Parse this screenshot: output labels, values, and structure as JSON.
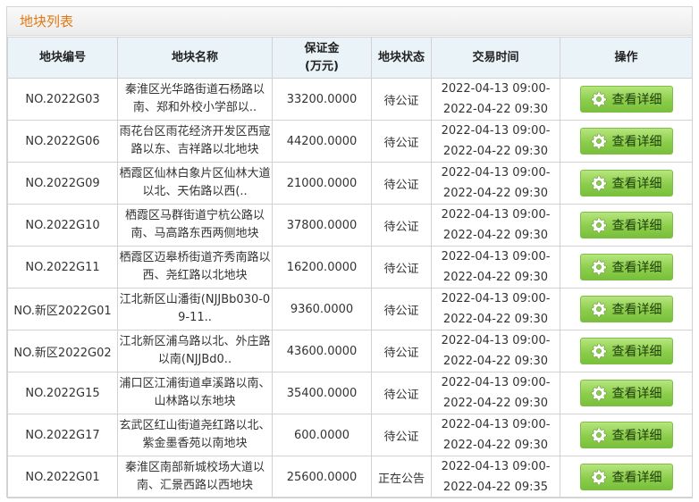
{
  "panel": {
    "title": "地块列表"
  },
  "table": {
    "headers": {
      "code": "地块编号",
      "name": "地块名称",
      "deposit_line1": "保证金",
      "deposit_line2": "(万元)",
      "status": "地块状态",
      "time": "交易时间",
      "action": "操作"
    },
    "rows": [
      {
        "code": "NO.2022G03",
        "name": "秦淮区光华路街道石杨路以南、郑和外校小学部以..",
        "deposit": "33200.0000",
        "status": "待公证",
        "time_start": "2022-04-13 09:00-",
        "time_end": "2022-04-22 09:30",
        "action": "查看详细"
      },
      {
        "code": "NO.2022G06",
        "name": "雨花台区雨花经济开发区西寇路以东、吉祥路以北地块",
        "deposit": "44200.0000",
        "status": "待公证",
        "time_start": "2022-04-13 09:00-",
        "time_end": "2022-04-22 09:30",
        "action": "查看详细"
      },
      {
        "code": "NO.2022G09",
        "name": "栖霞区仙林白象片区仙林大道以北、天佑路以西(..",
        "deposit": "21000.0000",
        "status": "待公证",
        "time_start": "2022-04-13 09:00-",
        "time_end": "2022-04-22 09:30",
        "action": "查看详细"
      },
      {
        "code": "NO.2022G10",
        "name": "栖霞区马群街道宁杭公路以南、马高路东西两侧地块",
        "deposit": "37800.0000",
        "status": "待公证",
        "time_start": "2022-04-13 09:00-",
        "time_end": "2022-04-22 09:30",
        "action": "查看详细"
      },
      {
        "code": "NO.2022G11",
        "name": "栖霞区迈皋桥街道齐秀南路以西、尧红路以北地块",
        "deposit": "16200.0000",
        "status": "待公证",
        "time_start": "2022-04-13 09:00-",
        "time_end": "2022-04-22 09:30",
        "action": "查看详细"
      },
      {
        "code": "NO.新区2022G01",
        "name": "江北新区山潘街(NJJBb030-09-11..",
        "deposit": "9360.0000",
        "status": "待公证",
        "time_start": "2022-04-13 09:00-",
        "time_end": "2022-04-22 09:30",
        "action": "查看详细"
      },
      {
        "code": "NO.新区2022G02",
        "name": "江北新区浦乌路以北、外庄路以南(NJJBd0..",
        "deposit": "43600.0000",
        "status": "待公证",
        "time_start": "2022-04-13 09:00-",
        "time_end": "2022-04-22 09:30",
        "action": "查看详细"
      },
      {
        "code": "NO.2022G15",
        "name": "浦口区江浦街道卓溪路以南、山林路以东地块",
        "deposit": "35400.0000",
        "status": "待公证",
        "time_start": "2022-04-13 09:00-",
        "time_end": "2022-04-22 09:30",
        "action": "查看详细"
      },
      {
        "code": "NO.2022G17",
        "name": "玄武区红山街道尧红路以北、紫金墨香苑以南地块",
        "deposit": "600.0000",
        "status": "待公证",
        "time_start": "2022-04-13 09:00-",
        "time_end": "2022-04-22 09:30",
        "action": "查看详细"
      },
      {
        "code": "NO.2022G01",
        "name": "秦淮区南部新城校场大道以南、汇景西路以西地块",
        "deposit": "25600.0000",
        "status": "正在公告",
        "time_start": "2022-04-13 09:00-",
        "time_end": "2022-04-22 09:35",
        "action": "查看详细"
      }
    ]
  },
  "colors": {
    "title": "#e07a10",
    "header_bg": "#eaf3f8",
    "button_green": "#8ccd4c",
    "border": "#d2d2d2"
  },
  "icons": {
    "button_icon": "gear-icon"
  }
}
